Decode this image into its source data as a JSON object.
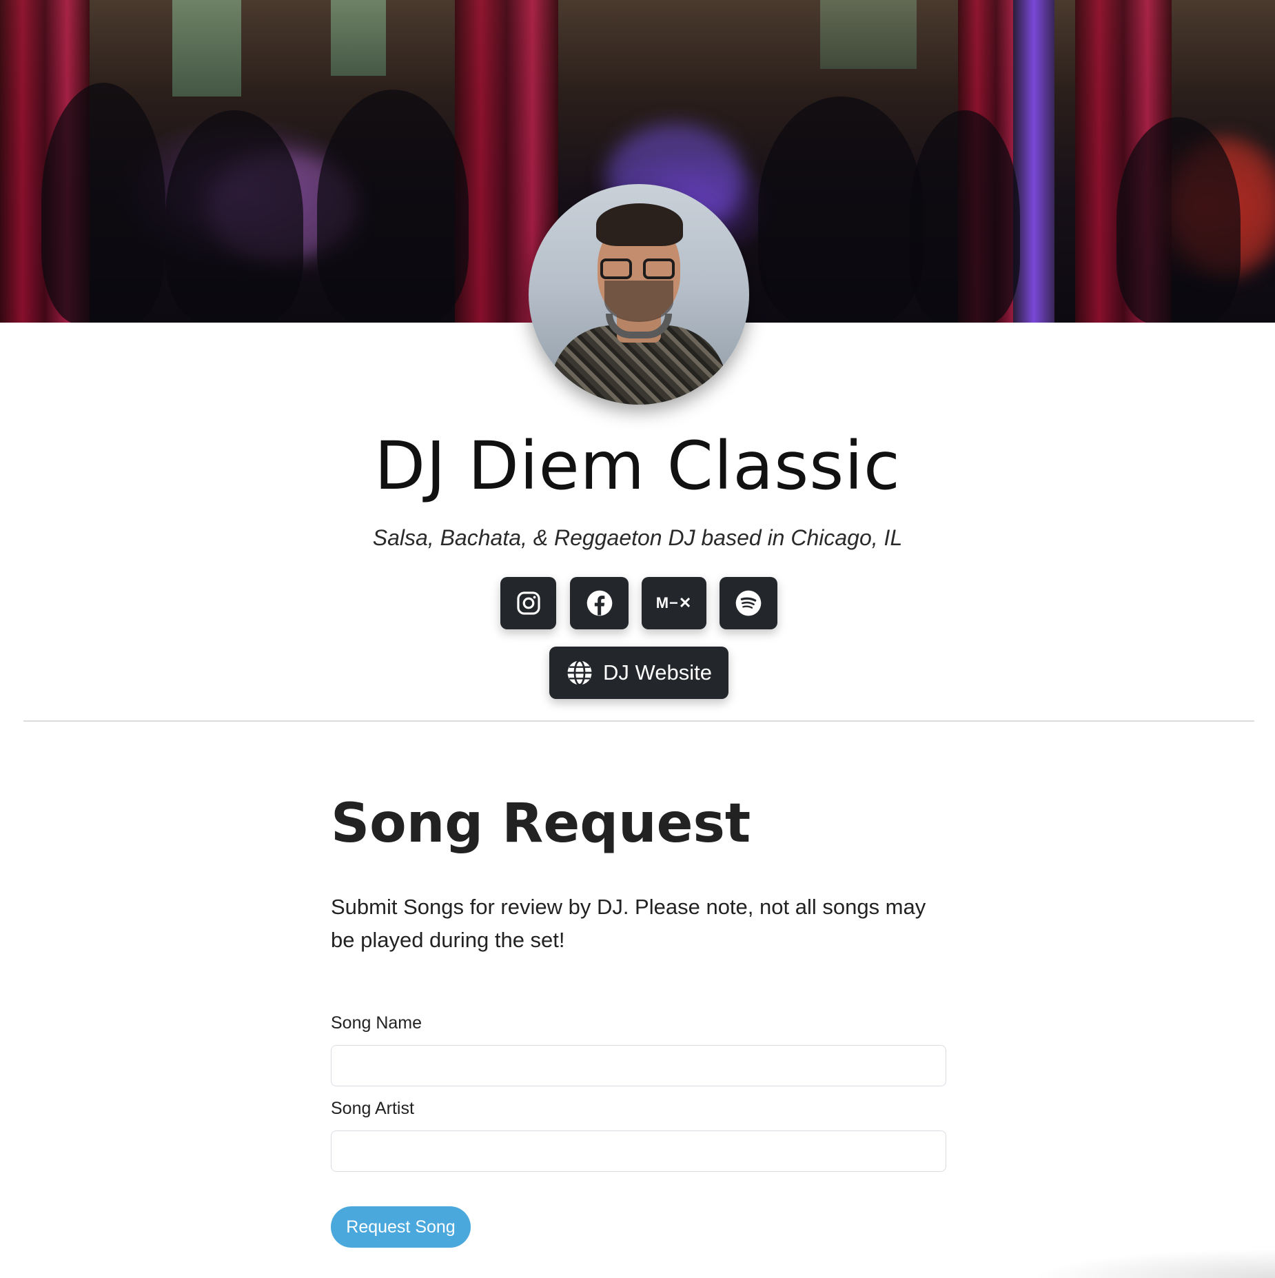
{
  "profile": {
    "name": "DJ Diem Classic",
    "tagline": "Salsa, Bachata, & Reggaeton DJ based in Chicago, IL",
    "website_label": "DJ Website"
  },
  "social_links": [
    {
      "name": "instagram",
      "icon": "instagram-icon"
    },
    {
      "name": "facebook",
      "icon": "facebook-icon"
    },
    {
      "name": "mixcloud",
      "icon": "mixcloud-icon",
      "glyph": "M−✕"
    },
    {
      "name": "spotify",
      "icon": "spotify-icon"
    }
  ],
  "request_form": {
    "title": "Song Request",
    "description": "Submit Songs for review by DJ. Please note, not all songs may be played during the set!",
    "song_name_label": "Song Name",
    "song_name_value": "",
    "song_artist_label": "Song Artist",
    "song_artist_value": "",
    "submit_label": "Request Song"
  },
  "colors": {
    "button_dark": "#23262b",
    "accent": "#4aa8dc",
    "divider": "#dcdcdc"
  }
}
